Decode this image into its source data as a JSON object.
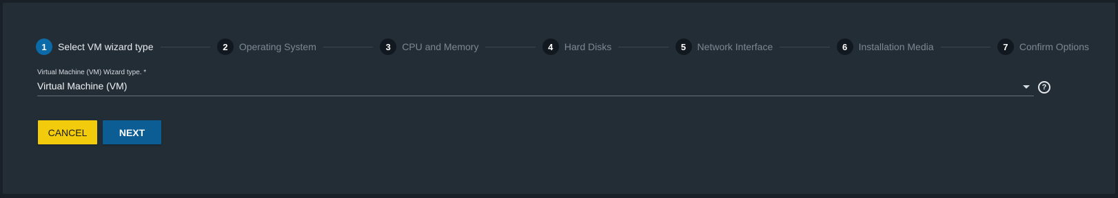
{
  "wizard": {
    "steps": [
      {
        "number": "1",
        "label": "Select VM wizard type",
        "active": true
      },
      {
        "number": "2",
        "label": "Operating System",
        "active": false
      },
      {
        "number": "3",
        "label": "CPU and Memory",
        "active": false
      },
      {
        "number": "4",
        "label": "Hard Disks",
        "active": false
      },
      {
        "number": "5",
        "label": "Network Interface",
        "active": false
      },
      {
        "number": "6",
        "label": "Installation Media",
        "active": false
      },
      {
        "number": "7",
        "label": "Confirm Options",
        "active": false
      }
    ]
  },
  "form": {
    "wizard_type": {
      "label": "Virtual Machine (VM) Wizard type. *",
      "value": "Virtual Machine (VM)",
      "help_icon": "help-icon",
      "help_glyph": "?"
    }
  },
  "actions": {
    "cancel_label": "CANCEL",
    "next_label": "NEXT"
  },
  "colors": {
    "background": "#232d36",
    "accent": "#0b6aa8",
    "cancel": "#f2cc0c",
    "next": "#0b5d94"
  }
}
